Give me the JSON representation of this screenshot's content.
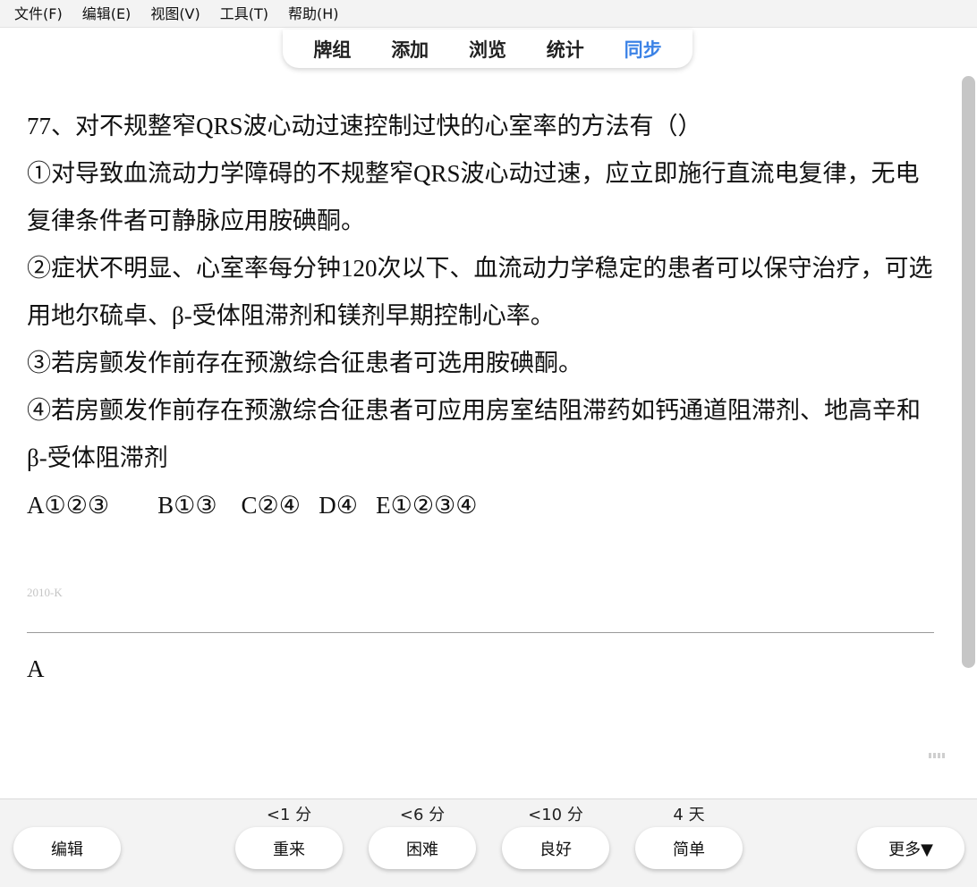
{
  "menu": [
    "文件(F)",
    "编辑(E)",
    "视图(V)",
    "工具(T)",
    "帮助(H)"
  ],
  "tabs": [
    "牌组",
    "添加",
    "浏览",
    "统计",
    "同步"
  ],
  "card": {
    "question": "77、对不规整窄QRS波心动过速控制过快的心室率的方法有（）",
    "items": [
      "①对导致血流动力学障碍的不规整窄QRS波心动过速，应立即施行直流电复律，无电复律条件者可静脉应用胺碘酮。",
      "②症状不明显、心室率每分钟120次以下、血流动力学稳定的患者可以保守治疗，可选用地尔硫卓、β-受体阻滞剂和镁剂早期控制心率。",
      "③若房颤发作前存在预激综合征患者可选用胺碘酮。",
      "④若房颤发作前存在预激综合征患者可应用房室结阻滞药如钙通道阻滞剂、地高辛和β-受体阻滞剂"
    ],
    "options": "A①②③        B①③    C②④   D④   E①②③④",
    "source": "2010-K",
    "answer": "A"
  },
  "bottom": {
    "edit_label": "编辑",
    "more_label": "更多▼",
    "intervals": [
      "<1 分",
      "<6 分",
      "<10 分",
      "4 天"
    ],
    "buttons": [
      "重来",
      "困难",
      "良好",
      "简单"
    ]
  }
}
